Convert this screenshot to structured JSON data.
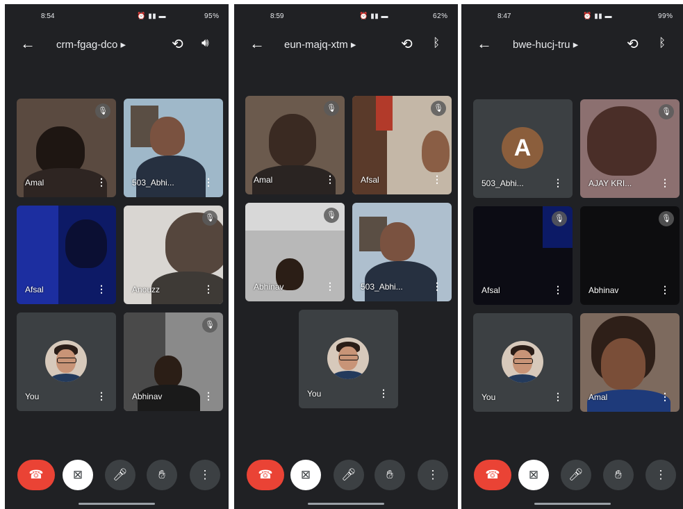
{
  "phones": [
    {
      "status": {
        "time": "8:54",
        "battery": "95%"
      },
      "meeting_code": "crm-fgag-dco",
      "aux_icon": "speaker-icon",
      "tiles": [
        {
          "name": "Amal",
          "muted": true
        },
        {
          "name": "503_Abhi...",
          "muted": false
        },
        {
          "name": "Afsal",
          "muted": false
        },
        {
          "name": "Anouzz",
          "muted": true
        },
        {
          "name": "You",
          "muted": false
        },
        {
          "name": "Abhinav",
          "muted": true
        }
      ]
    },
    {
      "status": {
        "time": "8:59",
        "battery": "62%"
      },
      "meeting_code": "eun-majq-xtm",
      "aux_icon": "bluetooth-icon",
      "tiles": [
        {
          "name": "Amal",
          "muted": true
        },
        {
          "name": "Afsal",
          "muted": true
        },
        {
          "name": "Abhinav",
          "muted": true
        },
        {
          "name": "503_Abhi...",
          "muted": false
        },
        {
          "name": "You",
          "muted": false
        }
      ]
    },
    {
      "status": {
        "time": "8:47",
        "battery": "99%"
      },
      "meeting_code": "bwe-hucj-tru",
      "aux_icon": "bluetooth-icon",
      "tiles": [
        {
          "name": "503_Abhi...",
          "avatar_letter": "A",
          "muted": false
        },
        {
          "name": "AJAY KRI...",
          "muted": true
        },
        {
          "name": "Afsal",
          "muted": true
        },
        {
          "name": "Abhinav",
          "muted": true
        },
        {
          "name": "You",
          "muted": false
        },
        {
          "name": "Amal",
          "muted": false
        }
      ]
    }
  ],
  "colors": {
    "background": "#202124",
    "tile": "#3c4043",
    "end_call": "#ea4335"
  }
}
